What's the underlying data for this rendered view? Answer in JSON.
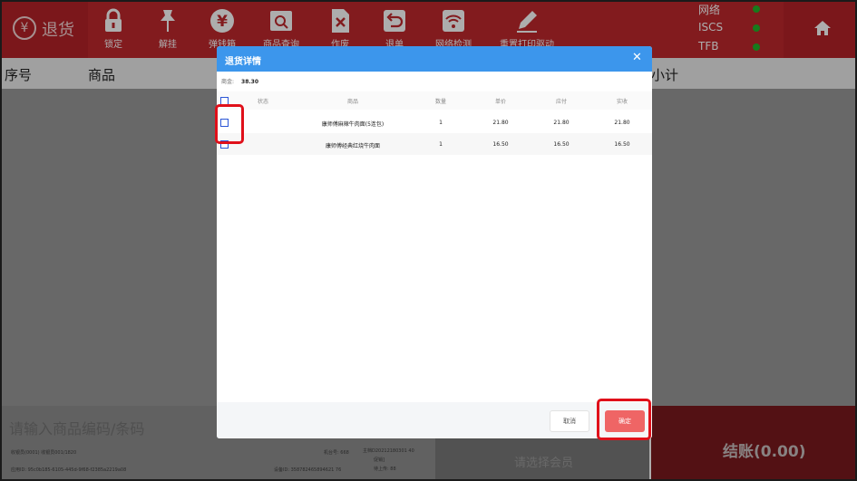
{
  "app": {
    "return_mode_icon": "¥",
    "return_mode_label": "退货"
  },
  "toolbar": [
    {
      "label": "锁定",
      "icon": "lock-icon"
    },
    {
      "label": "解挂",
      "icon": "pin-icon"
    },
    {
      "label": "弹钱箱",
      "icon": "yen-icon"
    },
    {
      "label": "商品查询",
      "icon": "search-product-icon"
    },
    {
      "label": "作废",
      "icon": "void-icon"
    },
    {
      "label": "退单",
      "icon": "return-icon"
    },
    {
      "label": "网络检测",
      "icon": "wifi-icon"
    },
    {
      "label": "重置打印驱动",
      "icon": "pen-icon"
    }
  ],
  "status": [
    {
      "label": "网络",
      "color": "#24b42a"
    },
    {
      "label": "ISCS",
      "color": "#24b42a"
    },
    {
      "label": "TFB",
      "color": "#24b42a"
    }
  ],
  "list_header": {
    "col_no": "序号",
    "col_product": "商品",
    "col_subtotal": "小计"
  },
  "bottom": {
    "barcode_placeholder": "请输入商品编码/条码",
    "cashier_line": "收银员(0001) 收银员001/1820",
    "device_line": "应用ID: 95c0b185-6105-445d-9f68-f2385a2219a08",
    "machine_no": "机台号: 668",
    "device_id": "设备ID: 358782465894621 76",
    "order_line_1": "主档D20212180301 40",
    "order_line_2": "促销]",
    "order_line_3": "待上传: 88",
    "member_label": "请选择会员",
    "checkout_label": "结账(0.00)"
  },
  "dialog": {
    "title": "退货详情",
    "close_symbol": "✕",
    "amount_label": "商金:",
    "amount_value": "38.30",
    "columns": {
      "status": "状态",
      "product": "商品",
      "qty": "数量",
      "unit_price": "单价",
      "payable": "应付",
      "paid": "实收"
    },
    "rows": [
      {
        "product": "康师傅麻辣牛肉面(5连包)",
        "qty": "1",
        "unit_price": "21.80",
        "payable": "21.80",
        "paid": "21.80"
      },
      {
        "product": "康师傅经典红烧牛肉面",
        "qty": "1",
        "unit_price": "16.50",
        "payable": "16.50",
        "paid": "16.50"
      }
    ],
    "cancel_label": "取消",
    "ok_label": "确定"
  },
  "colors": {
    "topbar": "#c0282d",
    "dialog_header": "#3c96ec",
    "ok_button": "#ef6565",
    "annotation": "#e0101a"
  }
}
